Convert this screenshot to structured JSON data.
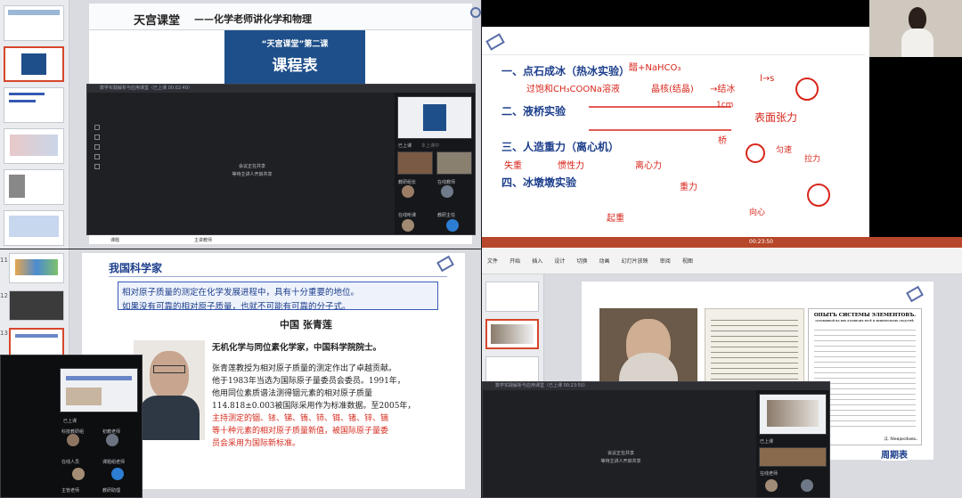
{
  "top_left": {
    "header_title": "天宫课堂",
    "header_subtitle": "——化学老师讲化学和物理",
    "banner_line1": "“天宫课堂”第二课",
    "banner_line2": "课程表",
    "meet_title": "数学实践解析与应用课堂（已上课 00:02:49）",
    "meet_center_line1": "会议正在共享",
    "meet_center_line2": "等待主讲人开启共享",
    "left_label": "课题",
    "right_label": "主讲教师",
    "status_text": "已上课",
    "status_sub": "本上课中",
    "participant_1": "教研组长",
    "participant_2": "在线教师",
    "participant_3": "在线听课",
    "participant_4": "教研主任"
  },
  "top_right": {
    "items": [
      {
        "label": "一、点石成冰（热冰实验）"
      },
      {
        "label": "二、液桥实验"
      },
      {
        "label": "三、人造重力（离心机）"
      },
      {
        "label": "四、冰墩墩实验"
      }
    ],
    "ink": {
      "a": "醋+NaHCO₃",
      "b": "过饱和CH₃COONa溶液",
      "c": "晶核(结晶)",
      "d": "→结冰",
      "e": "表面张力",
      "f": "离心力",
      "g": "惯性力",
      "h": "失重",
      "i": "重力",
      "j": "1cm",
      "k": "桥",
      "l": "匀速",
      "m": "拉力",
      "n": "起重",
      "o": "向心",
      "p": "l→s"
    }
  },
  "bottom_left": {
    "title": "我国科学家",
    "box_line1": "相对原子质量的测定在化学发展进程中，具有十分重要的地位。",
    "box_line2": "如果没有可靠的相对原子质量，也就不可能有可靠的分子式。",
    "name": "中国  张青莲",
    "intro": "无机化学与同位素化学家，中国科学院院士。",
    "p1": "张青莲教授为相对原子质量的测定作出了卓越贡献。",
    "p2": "他于1983年当选为国际原子量委员会委员。1991年，",
    "p3": "他用同位素质谱法测得铟元素的相对原子质量",
    "p4": "114.818±0.003被国际采用作为标准数据。至2005年，",
    "p5": "主持测定的铟、铱、锑、铕、铈、铒、锗、锌、镝",
    "p6": "等十种元素的相对原子质量新值，被国际原子量委",
    "p7": "员会采用为国际新标准。",
    "status_text": "已上课",
    "participant_1": "科技教研组",
    "participant_2": "初教老师",
    "participant_3": "在线人员",
    "participant_4": "课题组老师",
    "participant_5": "主管老师",
    "participant_6": "教研助理"
  },
  "bottom_right": {
    "timer": "00:23:50",
    "ribbon_tabs": [
      "文件",
      "开始",
      "插入",
      "设计",
      "切换",
      "动画",
      "幻灯片放映",
      "审阅",
      "视图"
    ],
    "table_title": "ОПЫТЪ СИСТЕМЫ ЭЛЕМЕНТОВЪ.",
    "table_subtitle": "основанной на ихъ атомномъ весѣ и химическомъ сходствѣ.",
    "signature": "Д. Менделѣевъ.",
    "caption": "周期表",
    "meet_title": "数学实践解析与应用课堂（已上课 00:23:50）",
    "meet_center_line1": "会议正在共享",
    "meet_center_line2": "等待主讲人开启共享",
    "status_text": "已上课",
    "participant_1": "在线老师"
  },
  "colors": {
    "accent_red": "#d62c1f",
    "navy": "#1d3f8c",
    "banner_blue": "#1e4f8a"
  }
}
